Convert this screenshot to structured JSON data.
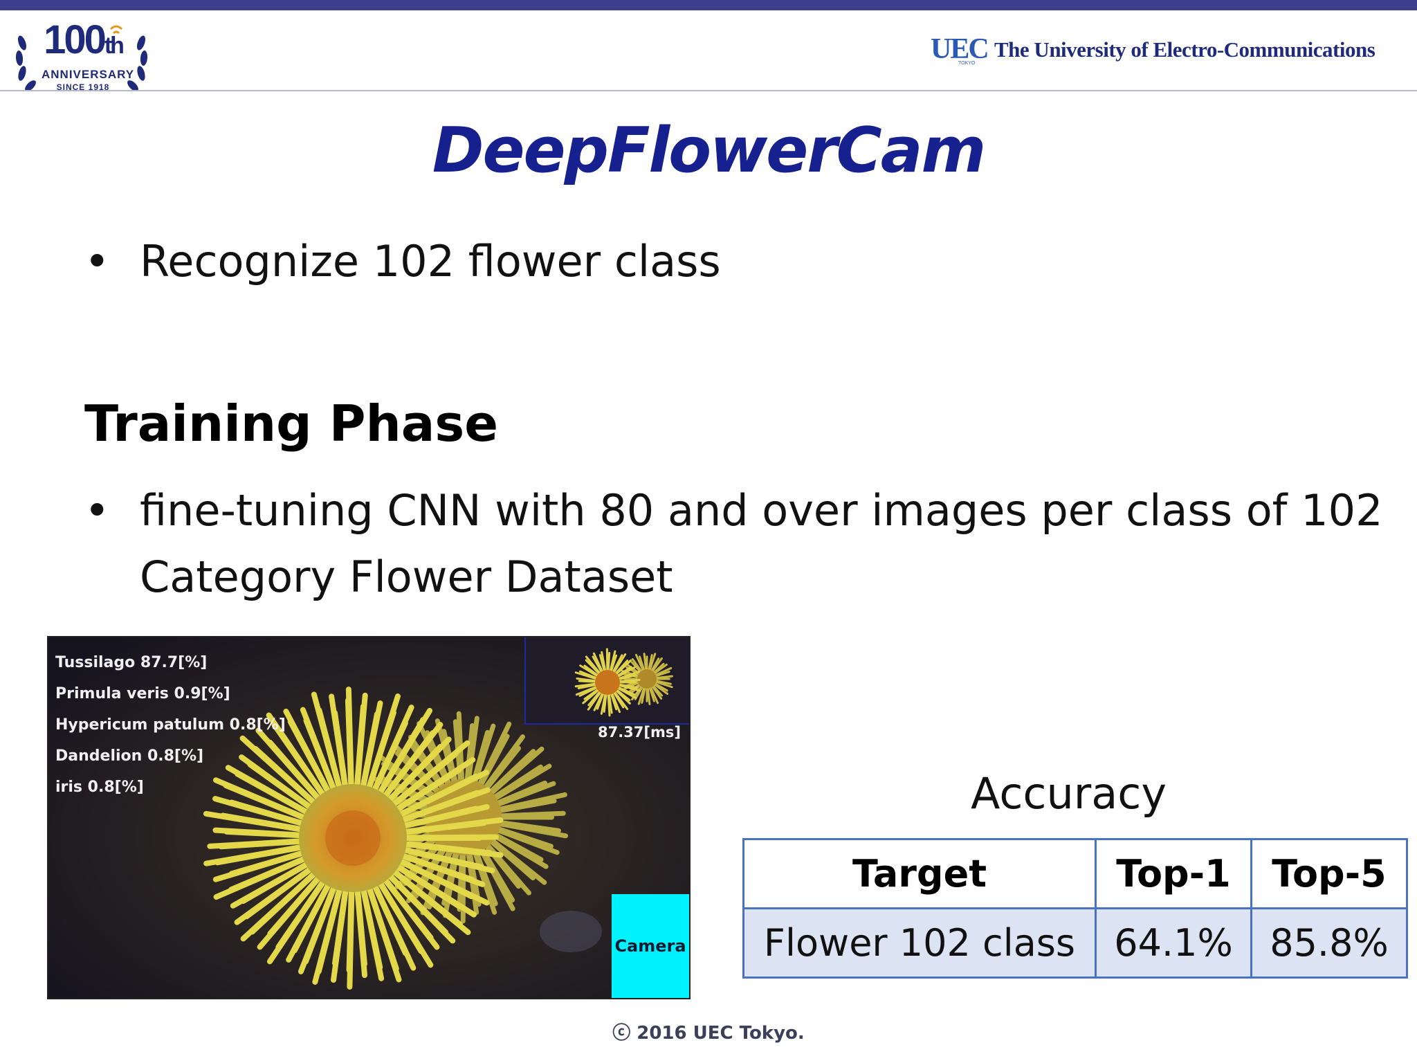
{
  "header": {
    "logo": {
      "number": "100",
      "suffix": "th",
      "line1": "ANNIVERSARY",
      "line2": "SINCE 1918"
    },
    "uec_mark": "UEC",
    "uec_sub": "TOKYO",
    "university": "The University of Electro-Communications"
  },
  "slide": {
    "title": "DeepFlowerCam",
    "bullet1": "Recognize 102 flower class",
    "section": "Training Phase",
    "bullet2": "fine-tuning CNN with 80 and over images per class of 102 Category Flower Dataset"
  },
  "camera_view": {
    "predictions": [
      "Tussilago 87.7[%]",
      "Primula veris 0.9[%]",
      "Hypericum patulum 0.8[%]",
      "Dandelion 0.8[%]",
      "iris 0.8[%]"
    ],
    "timing": "87.37[ms]",
    "button_label": "Camera"
  },
  "accuracy": {
    "title": "Accuracy",
    "headers": [
      "Target",
      "Top-1",
      "Top-5"
    ],
    "rows": [
      [
        "Flower 102 class",
        "64.1%",
        "85.8%"
      ]
    ]
  },
  "footer": {
    "copyright": "ⓒ 2016 UEC Tokyo."
  },
  "colors": {
    "title": "#17208f",
    "top_bar": "#3c3f8e",
    "table_border": "#4a72c4",
    "table_fill": "#dce3f3",
    "camera_button": "#00f2ff"
  }
}
